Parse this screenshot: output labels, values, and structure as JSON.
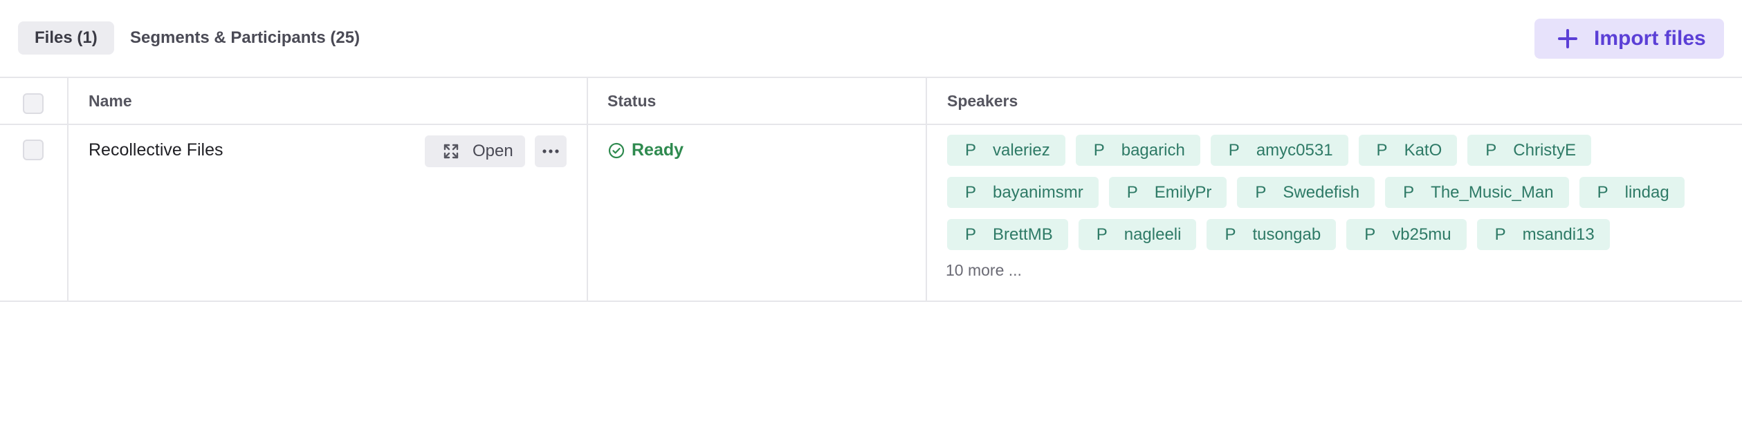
{
  "tabs": [
    {
      "label": "Files (1)",
      "active": true
    },
    {
      "label": "Segments & Participants (25)",
      "active": false
    }
  ],
  "import_button": {
    "label": "Import files",
    "icon": "plus-icon"
  },
  "table": {
    "headers": {
      "name": "Name",
      "status": "Status",
      "speakers": "Speakers"
    },
    "rows": [
      {
        "name": "Recollective Files",
        "open_label": "Open",
        "status": "Ready",
        "speakers": [
          "valeriez",
          "bagarich",
          "amyc0531",
          "KatO",
          "ChristyE",
          "bayanimsmr",
          "EmilyPr",
          "Swedefish",
          "The_Music_Man",
          "lindag",
          "BrettMB",
          "nagleeli",
          "tusongab",
          "vb25mu",
          "msandi13"
        ],
        "speaker_prefix": "P",
        "more_label": "10 more ..."
      }
    ]
  },
  "colors": {
    "accent": "#5b3fd6",
    "accent_bg": "#e7e2fb",
    "ready_green": "#2f8a4f",
    "chip_bg": "#e3f5ef",
    "chip_text": "#2e7a66"
  }
}
